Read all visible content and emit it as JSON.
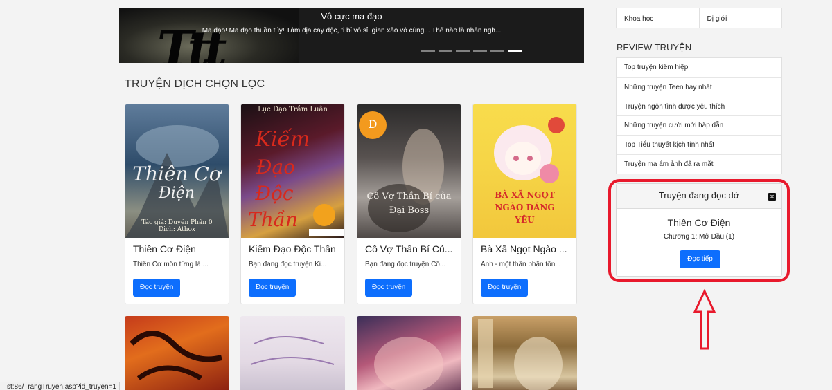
{
  "carousel": {
    "title": "Vô cực ma đạo",
    "description": "Ma đạo! Ma đạo thuần túy! Tâm địa cay độc, ti bỉ vô sỉ, gian xảo vô cùng... Thế nào là nhân ngh...",
    "indicator_count": 6,
    "active_indicator": 6
  },
  "section": {
    "title": "TRUYỆN DỊCH CHỌN LỌC"
  },
  "stories": [
    {
      "name": "Thiên Cơ Điện",
      "excerpt": "Thiên Cơ môn từng là ...",
      "button": "Đọc truyện",
      "cover_caption": "Tác giả: Duyên Phận 0\nDịch: Athox"
    },
    {
      "name": "Kiếm Đạo Độc Thần",
      "excerpt": "Bạn đang đọc truyện Ki...",
      "button": "Đọc truyện",
      "cover_caption": "Lục Đạo Trầm Luân"
    },
    {
      "name": "Cô Vợ Thần Bí Củ...",
      "excerpt": "Bạn đang đọc truyện Cô...",
      "button": "Đọc truyện",
      "cover_caption": "Cô Vợ Thần Bí của Đại Boss"
    },
    {
      "name": "Bà Xã Ngọt Ngào ...",
      "excerpt": "Anh - một thân phận tôn...",
      "button": "Đọc truyện",
      "cover_caption": "BÀ XÃ NGỌT NGÀO ĐÁNG YÊU"
    }
  ],
  "sidebar": {
    "genres": [
      "Khoa học",
      "Dị giới"
    ],
    "review_title": "REVIEW TRUYỆN",
    "review_items": [
      "Top truyện kiếm hiệp",
      "Những truyện Teen hay nhất",
      "Truyện ngôn tình được yêu thích",
      "Những truyện cười mới hấp dẫn",
      "Top Tiểu thuyết kịch tính nhất",
      "Truyện ma ám ảnh đã ra mắt"
    ]
  },
  "reading_box": {
    "title": "Truyện đang đọc dở",
    "close_glyph": "✕",
    "story_name": "Thiên Cơ Điện",
    "chapter": "Chương 1: Mở Đầu (1)",
    "button": "Đọc tiếp"
  },
  "annotation": {
    "highlight_color": "#e8192c"
  },
  "status_bar": {
    "url": "st:86/TrangTruyen.asp?id_truyen=1"
  },
  "colors": {
    "primary_button": "#0d6efd",
    "page_background": "#f3f3f3"
  }
}
